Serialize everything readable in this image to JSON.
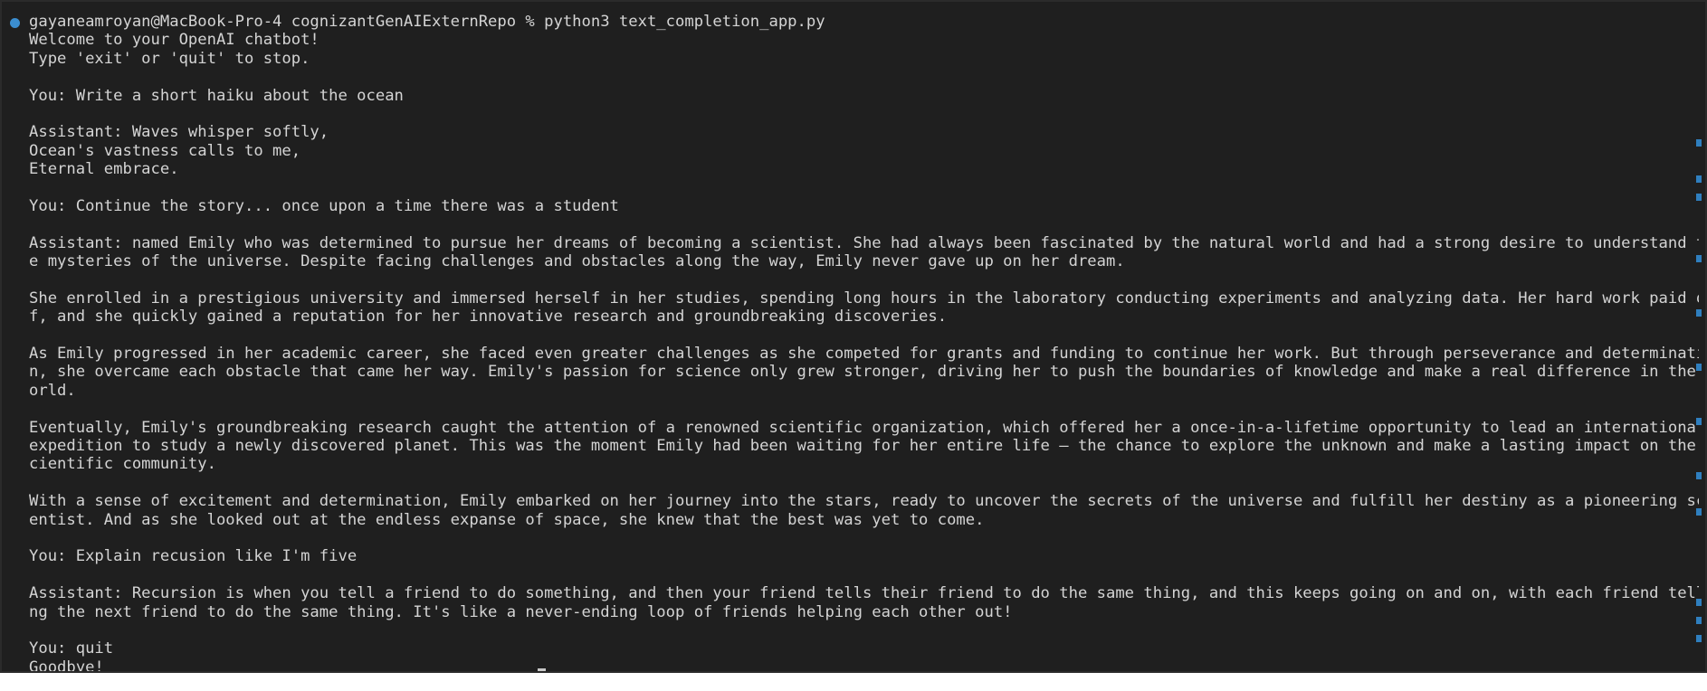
{
  "terminal": {
    "lines": [
      "gayaneamroyan@MacBook-Pro-4 cognizantGenAIExternRepo % python3 text_completion_app.py",
      "Welcome to your OpenAI chatbot!",
      "Type 'exit' or 'quit' to stop.",
      "",
      "You: Write a short haiku about the ocean",
      "",
      "Assistant: Waves whisper softly,",
      "Ocean's vastness calls to me,",
      "Eternal embrace.",
      "",
      "You: Continue the story... once upon a time there was a student",
      "",
      "Assistant: named Emily who was determined to pursue her dreams of becoming a scientist. She had always been fascinated by the natural world and had a strong desire to understand th",
      "e mysteries of the universe. Despite facing challenges and obstacles along the way, Emily never gave up on her dream.",
      "",
      "She enrolled in a prestigious university and immersed herself in her studies, spending long hours in the laboratory conducting experiments and analyzing data. Her hard work paid of",
      "f, and she quickly gained a reputation for her innovative research and groundbreaking discoveries.",
      "",
      "As Emily progressed in her academic career, she faced even greater challenges as she competed for grants and funding to continue her work. But through perseverance and determinatio",
      "n, she overcame each obstacle that came her way. Emily's passion for science only grew stronger, driving her to push the boundaries of knowledge and make a real difference in the w",
      "orld.",
      "",
      "Eventually, Emily's groundbreaking research caught the attention of a renowned scientific organization, which offered her a once-in-a-lifetime opportunity to lead an international",
      "expedition to study a newly discovered planet. This was the moment Emily had been waiting for her entire life – the chance to explore the unknown and make a lasting impact on the s",
      "cientific community.",
      "",
      "With a sense of excitement and determination, Emily embarked on her journey into the stars, ready to uncover the secrets of the universe and fulfill her destiny as a pioneering sci",
      "entist. And as she looked out at the endless expanse of space, she knew that the best was yet to come.",
      "",
      "You: Explain recusion like I'm five",
      "",
      "Assistant: Recursion is when you tell a friend to do something, and then your friend tells their friend to do the same thing, and this keeps going on and on, with each friend telli",
      "ng the next friend to do the same thing. It's like a never-ending loop of friends helping each other out!",
      "",
      "You: quit",
      "Goodbye!"
    ]
  },
  "colors": {
    "background": "#1f1f1f",
    "text": "#d4d4d4",
    "prompt_dot": "#3b8ed0",
    "scroll_marker": "#2f7fbf"
  }
}
